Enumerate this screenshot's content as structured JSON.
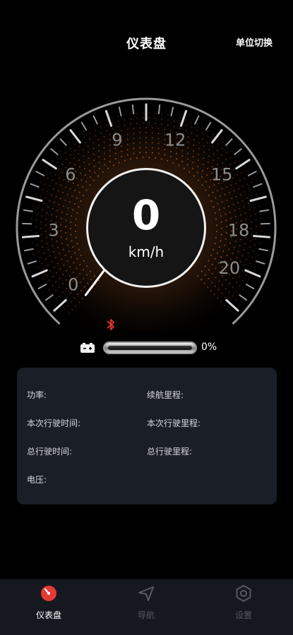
{
  "header": {
    "title": "仪表盘",
    "unit_switch": "单位切换"
  },
  "gauge": {
    "speed": "0",
    "unit": "km/h",
    "scale_labels": [
      "0",
      "3",
      "6",
      "9",
      "12",
      "15",
      "18",
      "20"
    ],
    "needle_speed": 0,
    "accent_color": "#c8692a"
  },
  "status": {
    "bluetooth_icon": "bluetooth-icon",
    "bluetooth_color": "#e53935",
    "battery_icon": "battery-icon",
    "battery_level": 0,
    "battery_percent": "0%"
  },
  "info": {
    "power": "功率:",
    "range": "续航里程:",
    "trip_time": "本次行驶时间:",
    "trip_distance": "本次行驶里程:",
    "total_time": "总行驶时间:",
    "total_distance": "总行驶里程:",
    "voltage": "电压:"
  },
  "tabs": [
    {
      "label": "仪表盘",
      "icon": "dashboard-icon",
      "active": true
    },
    {
      "label": "导航",
      "icon": "navigation-icon",
      "active": false
    },
    {
      "label": "设置",
      "icon": "settings-icon",
      "active": false
    }
  ],
  "colors": {
    "active_tab": "#e53935",
    "inactive_tab": "#555a63",
    "card_bg": "#1a1e27"
  }
}
